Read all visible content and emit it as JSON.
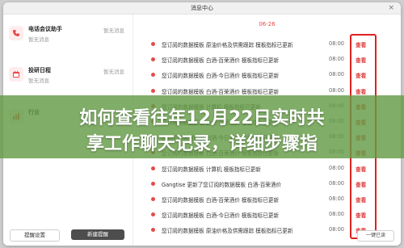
{
  "window": {
    "title": "消息中心",
    "close_glyph": "×"
  },
  "sidebar": {
    "items": [
      {
        "name": "电话会议助手",
        "sub": "暂无消息",
        "time": "暂无消息",
        "icon": "phone-icon"
      },
      {
        "name": "投研日程",
        "sub": "暂无消息",
        "time": "暂无消息",
        "icon": "calendar-icon"
      },
      {
        "name": "行业",
        "sub": "",
        "time": "",
        "icon": "chart-icon"
      }
    ],
    "buttons": {
      "settings": "提醒设置",
      "new": "新建提醒"
    }
  },
  "main": {
    "date": "06-26",
    "view_label": "查看",
    "rows": [
      {
        "text": "您订阅的数据模板 原油价格及供需跟踪 模板指标已更新",
        "time": "08:00"
      },
      {
        "text": "您订阅的数据模板 白酒-百荣酒价 模板指标已更新",
        "time": "08:00"
      },
      {
        "text": "您订阅的数据模板 白酒-今日酒价 模板指标已更新",
        "time": "08:00"
      },
      {
        "text": "您订阅的数据模板 白酒-百荣酒价 模板指标已更新",
        "time": "08:00"
      },
      {
        "text": "您订阅的数据模板 计算机 模板指标已更新",
        "time": "08:00"
      },
      {
        "text": "您订阅的数据模板 白酒-百荣酒价 模板指标已更新",
        "time": "08:00"
      },
      {
        "text": "您订阅的数据模板 白酒-今日酒价 模板指标已更新",
        "time": "08:00"
      },
      {
        "text": "您订阅的数据模板 白酒-百荣酒价 模板指标已更新",
        "time": "08:00"
      },
      {
        "text": "您订阅的数据模板 计算机 模板指标已更新",
        "time": "08:00"
      },
      {
        "text": "Gangtise 更新了您订阅的数据模板 白酒-百荣酒价",
        "time": "08:00"
      },
      {
        "text": "您订阅的数据模板 白酒-百荣酒价 模板指标已更新",
        "time": "08:00"
      },
      {
        "text": "您订阅的数据模板 白酒-今日酒价 模板指标已更新",
        "time": "08:00"
      },
      {
        "text": "您订阅的数据模板 原油价格及供需跟踪 模板指标已更新",
        "time": "08:00"
      }
    ],
    "bottom_button": "一键已读"
  },
  "banner": {
    "line1": "如何查看往年12月22日实时共",
    "line2": "享工作聊天记录，详细步骤指"
  },
  "colors": {
    "accent": "#e64a4a",
    "banner": "#649b46"
  }
}
